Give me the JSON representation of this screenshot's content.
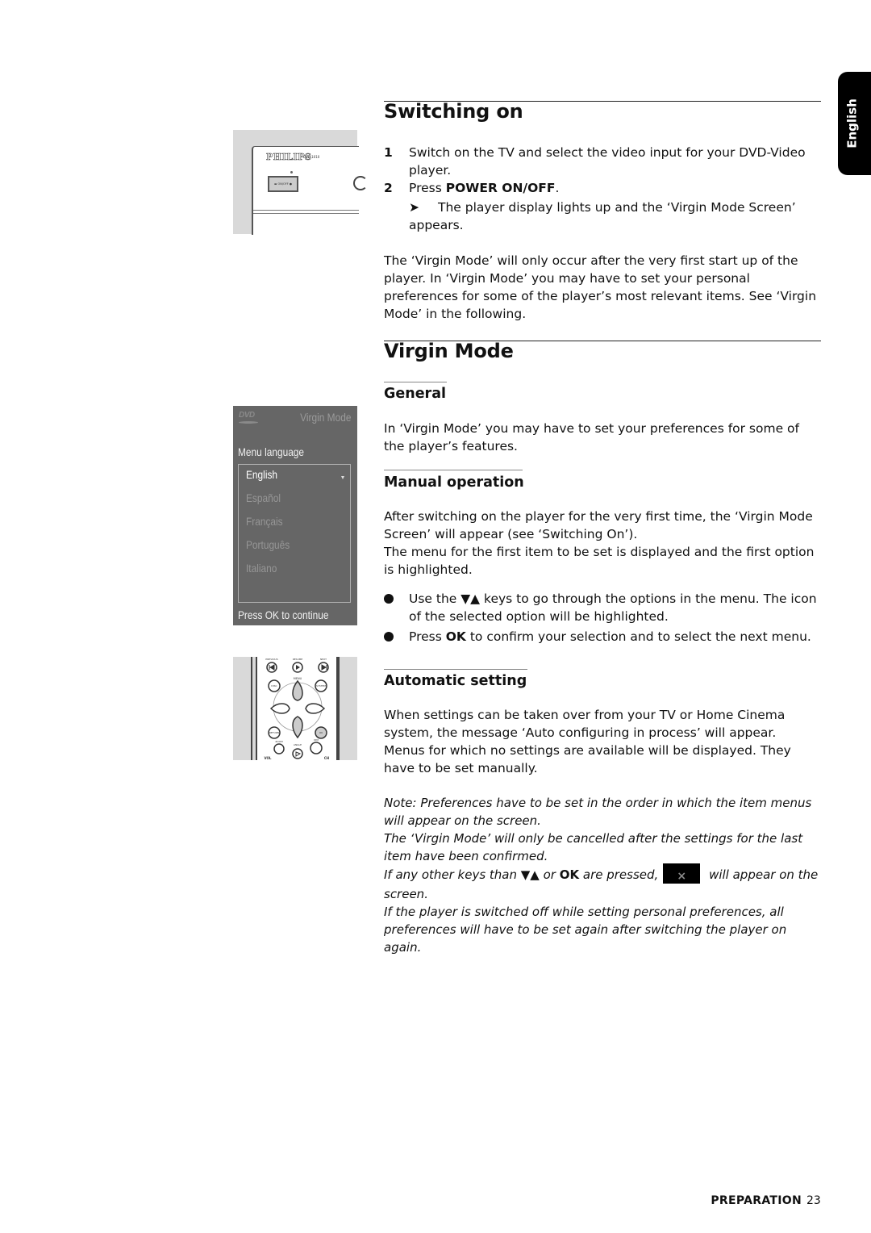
{
  "side_tab": {
    "label": "English"
  },
  "switching_on": {
    "title": "Switching on",
    "steps": [
      {
        "num": "1",
        "text": "Switch on the TV and select the video input for your DVD-Video player."
      },
      {
        "num": "2",
        "prefix": "Press ",
        "bold": "POWER ON/OFF",
        "suffix": "."
      }
    ],
    "result_arrow": "➤",
    "result_text": "The player display lights up and the ‘Virgin Mode Screen’ appears.",
    "paragraph": "The ‘Virgin Mode’ will only occur after the very first start up of the player. In ‘Virgin Mode’ you may have to set your personal preferences for some of the player’s most relevant items. See ‘Virgin Mode’ in the following."
  },
  "virgin_mode": {
    "title": "Virgin Mode",
    "general": {
      "heading": "General",
      "text": "In ‘Virgin Mode’ you may have to set your preferences for some of the player’s features."
    },
    "manual": {
      "heading": "Manual operation",
      "text1": "After switching on the player for the very first time, the ‘Virgin Mode Screen’ will appear (see ‘Switching On’).",
      "text2": "The menu for the first item to be set is displayed and the first option is highlighted.",
      "bullets": [
        {
          "pre": "Use the ▼▲ keys to go through the options in the menu. The icon of the selected option will be highlighted."
        },
        {
          "pre": "Press ",
          "bold": "OK",
          "post": " to confirm your selection and to select the next menu."
        }
      ]
    },
    "automatic": {
      "heading": "Automatic setting",
      "text1": "When settings can be taken over from your TV or Home Cinema system, the message ‘Auto configuring in process’ will appear.",
      "text2": "Menus for which no settings are available will be displayed. They have to be set manually."
    },
    "notes": {
      "n1": "Note: Preferences have to be set in the order in which the item menus will appear on the screen.",
      "n2": "The ‘Virgin Mode’ will only be cancelled after the settings for the last item have been confirmed.",
      "n3_pre": "If any other keys than ▼▲ or ",
      "n3_bold": "OK",
      "n3_mid": " are pressed,",
      "n3_icon": "×",
      "n3_post": " will appear on the screen.",
      "n4": "If the player is switched off while setting personal preferences, all preferences will have to be set again after switching the player on again."
    }
  },
  "illustrations": {
    "front_panel": {
      "brand": "PHILIPS",
      "model": "DVD 1010",
      "button": "▬ ON/OFF ●"
    },
    "osd": {
      "logo": "DVD",
      "title": "Virgin Mode",
      "heading": "Menu language",
      "options": [
        {
          "label": "English",
          "selected": true
        },
        {
          "label": "Español",
          "selected": false
        },
        {
          "label": "Français",
          "selected": false
        },
        {
          "label": "Português",
          "selected": false
        },
        {
          "label": "Italiano",
          "selected": false
        }
      ],
      "footer": "Press OK to continue"
    },
    "remote": {
      "top_labels": [
        "PREVIOUS",
        "RESUME",
        "NEXT"
      ],
      "menu_label": "MENU",
      "disc": "DISC",
      "system": "SYSTEM",
      "return": "RETURN",
      "ok": "OK",
      "zoom": "ZOOM",
      "angle": "ANGLE",
      "dim": "DIM",
      "vol": "VOL",
      "ch": "CH"
    }
  },
  "footer": {
    "section": "PREPARATION",
    "page": "23"
  }
}
